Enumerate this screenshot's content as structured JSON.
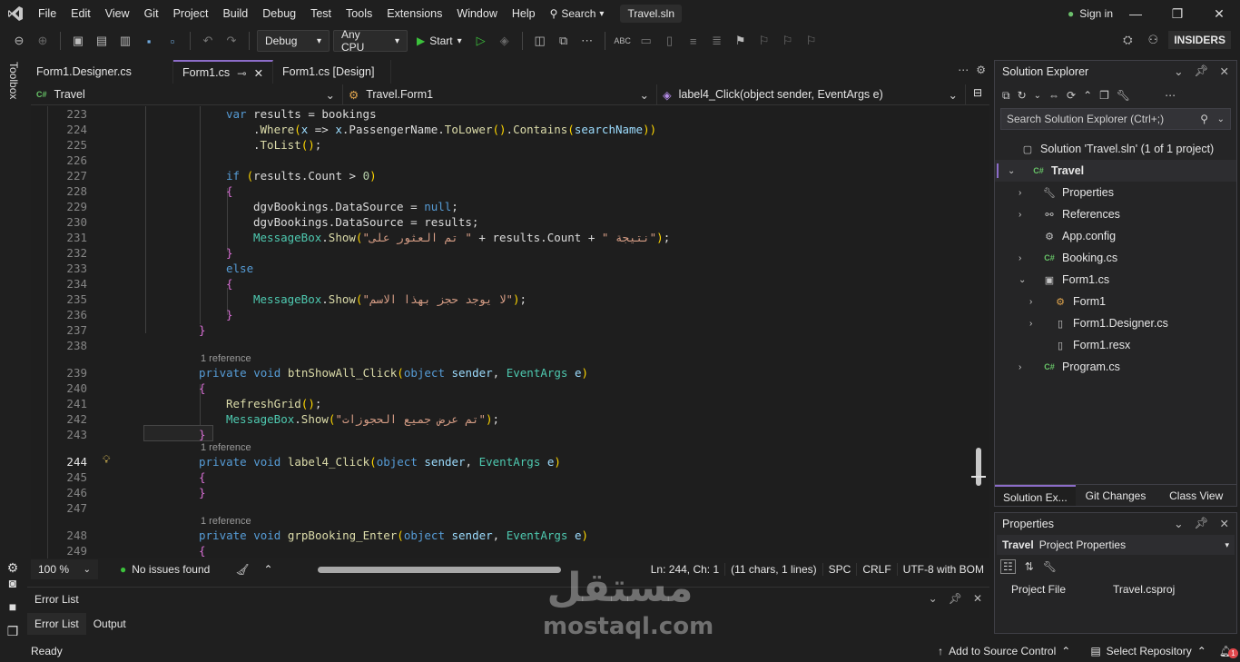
{
  "menu": {
    "items": [
      "File",
      "Edit",
      "View",
      "Git",
      "Project",
      "Build",
      "Debug",
      "Test",
      "Tools",
      "Extensions",
      "Window",
      "Help"
    ],
    "search_label": "Search",
    "solution_badge": "Travel.sln",
    "sign_in": "Sign in"
  },
  "toolbar": {
    "config": "Debug",
    "platform": "Any CPU",
    "start": "Start",
    "insiders": "INSIDERS"
  },
  "toolbox_label": "Toolbox",
  "doc_tabs": [
    {
      "label": "Form1.Designer.cs",
      "active": false
    },
    {
      "label": "Form1.cs",
      "active": true
    },
    {
      "label": "Form1.cs [Design]",
      "active": false
    }
  ],
  "navbar": {
    "project": "Travel",
    "class": "Travel.Form1",
    "member": "label4_Click(object sender, EventArgs e)"
  },
  "editor": {
    "current_line": "244",
    "ref_hint": "1 reference",
    "lines": [
      {
        "n": "223",
        "t": "var results = bookings"
      },
      {
        "n": "224",
        "t": ".Where(x => x.PassengerName.ToLower().Contains(searchName))"
      },
      {
        "n": "225",
        "t": ".ToList();"
      },
      {
        "n": "226",
        "t": ""
      },
      {
        "n": "227",
        "t": "if (results.Count > 0)"
      },
      {
        "n": "228",
        "t": "{"
      },
      {
        "n": "229",
        "t": "dgvBookings.DataSource = null;"
      },
      {
        "n": "230",
        "t": "dgvBookings.DataSource = results;"
      },
      {
        "n": "231",
        "t": "MessageBox.Show(\"تم العثور على \" + results.Count + \" نتيجة\");"
      },
      {
        "n": "232",
        "t": "}"
      },
      {
        "n": "233",
        "t": "else"
      },
      {
        "n": "234",
        "t": "{"
      },
      {
        "n": "235",
        "t": "MessageBox.Show(\"لا يوجد حجز بهذا الاسم\");"
      },
      {
        "n": "236",
        "t": "}"
      },
      {
        "n": "237",
        "t": "}"
      },
      {
        "n": "238",
        "t": ""
      },
      {
        "n": "239",
        "t": "private void btnShowAll_Click(object sender, EventArgs e)"
      },
      {
        "n": "240",
        "t": "{"
      },
      {
        "n": "241",
        "t": "RefreshGrid();"
      },
      {
        "n": "242",
        "t": "MessageBox.Show(\"تم عرض جميع الحجوزات\");"
      },
      {
        "n": "243",
        "t": "}"
      },
      {
        "n": "244",
        "t": "private void label4_Click(object sender, EventArgs e)"
      },
      {
        "n": "245",
        "t": "{"
      },
      {
        "n": "246",
        "t": "}"
      },
      {
        "n": "247",
        "t": ""
      },
      {
        "n": "248",
        "t": "private void grpBooking_Enter(object sender, EventArgs e)"
      },
      {
        "n": "249",
        "t": "{"
      }
    ]
  },
  "editor_status": {
    "zoom": "100 %",
    "issues": "No issues found",
    "position": "Ln: 244, Ch: 1",
    "selection": "(11 chars, 1 lines)",
    "whitespace": "SPC",
    "line_endings": "CRLF",
    "encoding": "UTF-8 with BOM"
  },
  "error_list": {
    "title": "Error List",
    "tabs": [
      "Error List",
      "Output"
    ]
  },
  "status": {
    "ready": "Ready",
    "source_control": "Add to Source Control",
    "repository": "Select Repository",
    "notifications": "1"
  },
  "solution_explorer": {
    "title": "Solution Explorer",
    "search_placeholder": "Search Solution Explorer (Ctrl+;)",
    "tree": [
      {
        "label": "Solution 'Travel.sln' (1 of 1 project)",
        "level": 0,
        "icon": "solution-icon",
        "expander": "",
        "selected": false
      },
      {
        "label": "Travel",
        "level": 0,
        "icon": "csharp-project-icon",
        "expander": "open",
        "selected": true
      },
      {
        "label": "Properties",
        "level": 1,
        "icon": "wrench-icon",
        "expander": "closed",
        "selected": false
      },
      {
        "label": "References",
        "level": 1,
        "icon": "references-icon",
        "expander": "closed",
        "selected": false
      },
      {
        "label": "App.config",
        "level": 1,
        "icon": "config-icon",
        "expander": "",
        "selected": false
      },
      {
        "label": "Booking.cs",
        "level": 1,
        "icon": "csharp-file-icon",
        "expander": "closed",
        "selected": false
      },
      {
        "label": "Form1.cs",
        "level": 1,
        "icon": "form-icon",
        "expander": "open",
        "selected": false
      },
      {
        "label": "Form1",
        "level": 2,
        "icon": "class-icon",
        "expander": "closed",
        "selected": false
      },
      {
        "label": "Form1.Designer.cs",
        "level": 2,
        "icon": "file-icon",
        "expander": "closed",
        "selected": false
      },
      {
        "label": "Form1.resx",
        "level": 2,
        "icon": "file-icon",
        "expander": "",
        "selected": false
      },
      {
        "label": "Program.cs",
        "level": 1,
        "icon": "csharp-file-icon",
        "expander": "closed",
        "selected": false
      }
    ],
    "bottom_tabs": [
      "Solution Ex...",
      "Git Changes",
      "Class View"
    ]
  },
  "properties": {
    "title": "Properties",
    "object_name": "Travel",
    "object_type": "Project Properties",
    "rows": [
      {
        "key": "Project File",
        "value": "Travel.csproj"
      }
    ]
  },
  "watermark": {
    "arabic": "مستقل",
    "latin": "mostaql.com"
  }
}
